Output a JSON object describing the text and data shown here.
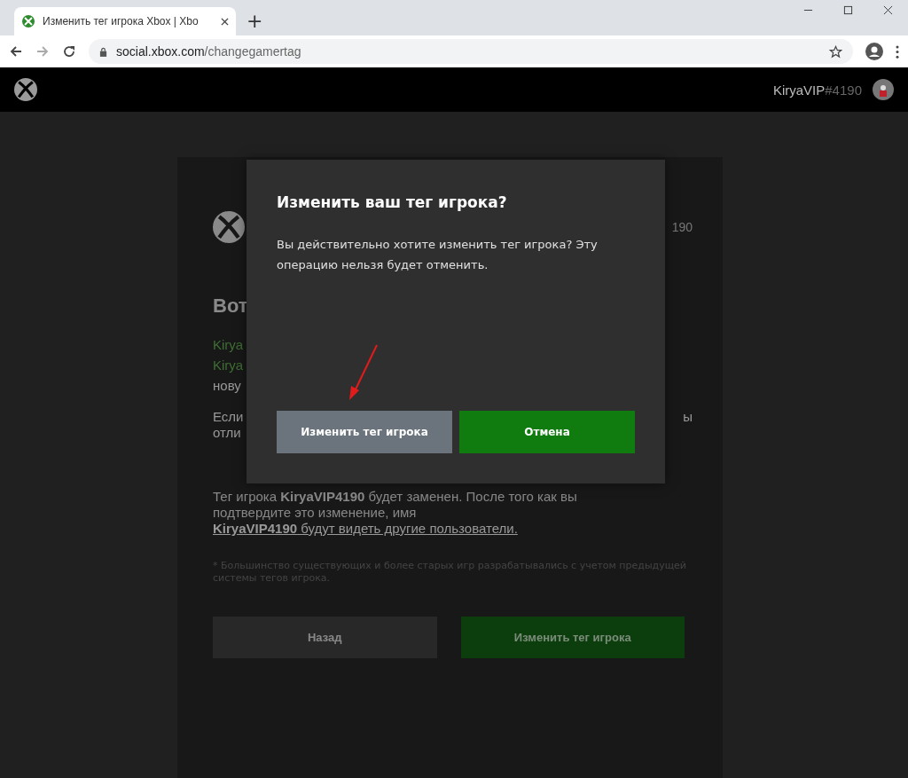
{
  "browser": {
    "tab_title": "Изменить тег игрока Xbox | Xbo",
    "new_tab": "+",
    "url_host": "social.xbox.com",
    "url_path": "/changegamertag"
  },
  "header": {
    "gamertag": "KiryaVIP",
    "suffix": "#4190"
  },
  "page": {
    "tag_fragment": "190",
    "heading_fragment": "Вот",
    "lines": [
      {
        "text": "Kirya",
        "kind": "green"
      },
      {
        "text": "Kirya",
        "kind": "green"
      },
      {
        "text": "нову",
        "kind": "plain"
      }
    ],
    "if_fragments": [
      {
        "left": "Если",
        "right": "ы"
      },
      {
        "left": "отли"
      }
    ],
    "notice": {
      "text": "Тег игрока **KiryaVIP4190** будет заменен. После того как вы подтвердите это изменение, имя ",
      "link": "**KiryaVIP4190** будут видеть другие пользователи."
    },
    "footnote": "* Большинство существующих и более старых игр разрабатывались с учетом предыдущей системы тегов игрока.",
    "buttons": [
      {
        "label": "Назад",
        "kind": "secondary"
      },
      {
        "label": "Изменить тег игрока",
        "kind": "primary"
      }
    ]
  },
  "dialog": {
    "title": "Изменить ваш тег игрока?",
    "message": "Вы действительно хотите изменить тег игрока? Эту операцию нельзя будет отменить.",
    "buttons": [
      {
        "label": "Изменить тег игрока",
        "kind": "secondary"
      },
      {
        "label": "Отмена",
        "kind": "primary"
      }
    ]
  }
}
